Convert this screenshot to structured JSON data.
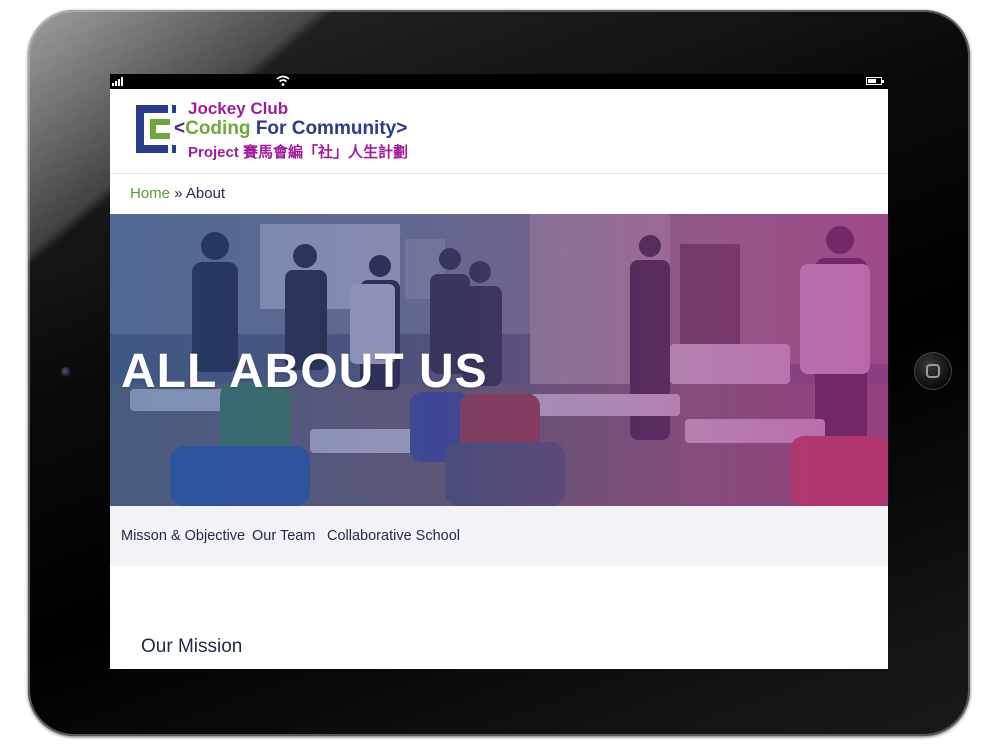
{
  "logo": {
    "line1": "Jockey Club",
    "line2_open": "<",
    "line2_word1": "Coding",
    "line2_word2": "For",
    "line2_word3": "Community",
    "line2_close": ">",
    "line3_en": "Project",
    "line3_zh": "賽馬會編「社」人生計劃"
  },
  "breadcrumb": {
    "home": "Home",
    "separator": "»",
    "current": "About"
  },
  "hero": {
    "title": "ALL ABOUT US"
  },
  "subnav": {
    "items": [
      "Misson & Objective",
      "Our Team",
      "Collaborative School"
    ]
  },
  "section": {
    "title": "Our Mission"
  },
  "colors": {
    "brand_purple": "#a21c9a",
    "brand_green": "#6ea83a",
    "brand_navy": "#2a3c8c",
    "breadcrumb_link": "#5c9a3a",
    "subnav_bg": "#f2f2f7",
    "text_dark": "#1f2a44"
  },
  "device": {
    "type": "tablet",
    "status_icons": [
      "signal-icon",
      "wifi-icon",
      "battery-icon"
    ]
  }
}
